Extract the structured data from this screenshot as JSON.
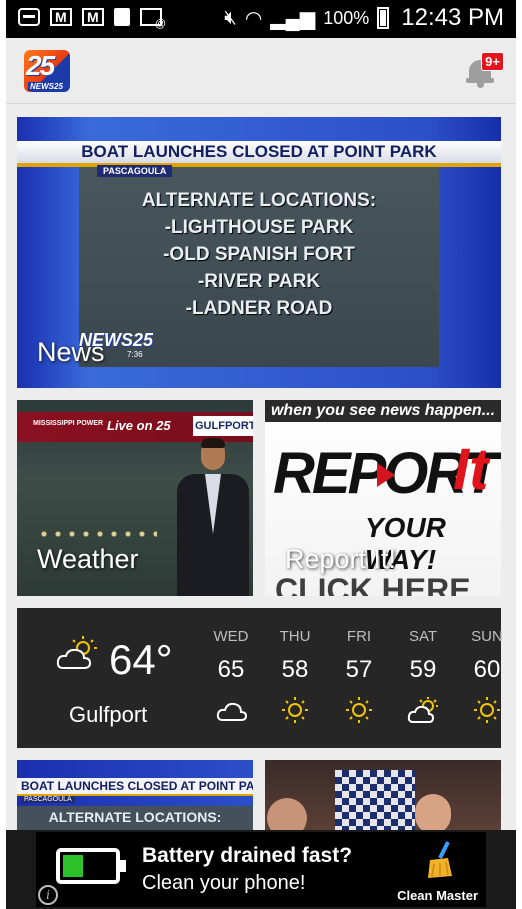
{
  "status_bar": {
    "battery_percent": "100%",
    "time": "12:43 PM"
  },
  "app_bar": {
    "logo_number": "25",
    "logo_text": "NEWS25",
    "notification_badge": "9+"
  },
  "tiles": {
    "news": {
      "label": "News",
      "headline": "BOAT LAUNCHES CLOSED AT POINT PARK",
      "location": "PASCAGOULA",
      "lines": [
        "ALTERNATE LOCATIONS:",
        "-LIGHTHOUSE PARK",
        "-OLD SPANISH FORT",
        "-RIVER PARK",
        "-LADNER ROAD"
      ],
      "bug": "NEWS25",
      "bug_time": "7:36"
    },
    "weather": {
      "label": "Weather",
      "sponsor": "MISSISSIPPI POWER",
      "live": "Live on 25",
      "tag": "GULFPORT"
    },
    "report": {
      "label": "Report It!",
      "top_text": "when you see news happen...",
      "logo_main": "REPORT",
      "logo_it": "It",
      "tagline": "YOUR WAY!",
      "cta": "CLICK HERE"
    }
  },
  "forecast": {
    "current_temp": "64°",
    "city": "Gulfport",
    "current_icon": "partly-cloudy-icon",
    "days": [
      {
        "name": "WED",
        "temp": "65",
        "icon": "cloud-icon"
      },
      {
        "name": "THU",
        "temp": "58",
        "icon": "sun-icon"
      },
      {
        "name": "FRI",
        "temp": "57",
        "icon": "sun-icon"
      },
      {
        "name": "SAT",
        "temp": "59",
        "icon": "partly-cloudy-icon"
      },
      {
        "name": "SUN",
        "temp": "60",
        "icon": "sun-icon"
      }
    ]
  },
  "bottom_tiles": {
    "left_headline": "BOAT LAUNCHES CLOSED AT POINT PARK",
    "left_location": "PASCAGOULA",
    "left_body": "ALTERNATE LOCATIONS:"
  },
  "ad": {
    "line1": "Battery drained fast?",
    "line2": "Clean your phone!",
    "brand": "Clean Master",
    "info": "i",
    "battery_level": 0.4
  },
  "colors": {
    "accent_red": "#e3141b",
    "forecast_bg": "#262626",
    "sun_yellow": "#f5c400",
    "battery_green": "#2cc12a"
  }
}
